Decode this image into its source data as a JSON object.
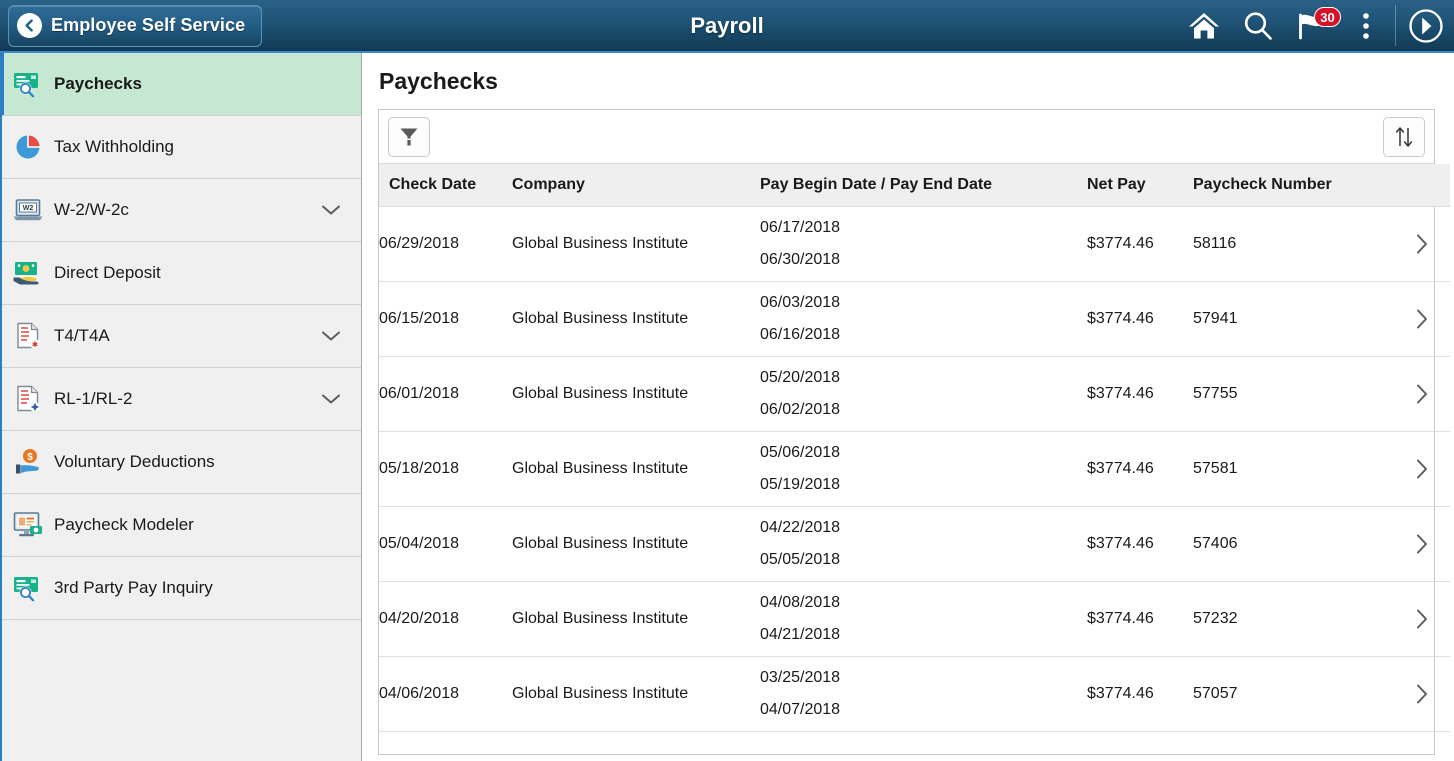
{
  "header": {
    "back_label": "Employee Self Service",
    "title": "Payroll",
    "notification_count": "30",
    "icons": {
      "home": "home-icon",
      "search": "search-icon",
      "notifications": "flag-icon",
      "actions": "kebab-menu-icon",
      "navigator": "navigator-compass-icon"
    }
  },
  "sidebar": {
    "items": [
      {
        "label": "Paychecks",
        "icon": "paycheck-search-icon",
        "selected": true,
        "expandable": false
      },
      {
        "label": "Tax Withholding",
        "icon": "pie-chart-icon",
        "selected": false,
        "expandable": false
      },
      {
        "label": "W-2/W-2c",
        "icon": "w2-laptop-icon",
        "selected": false,
        "expandable": true
      },
      {
        "label": "Direct Deposit",
        "icon": "money-hand-icon",
        "selected": false,
        "expandable": false
      },
      {
        "label": "T4/T4A",
        "icon": "t4-document-icon",
        "selected": false,
        "expandable": true
      },
      {
        "label": "RL-1/RL-2",
        "icon": "rl1-document-icon",
        "selected": false,
        "expandable": true
      },
      {
        "label": "Voluntary Deductions",
        "icon": "hand-coin-icon",
        "selected": false,
        "expandable": false
      },
      {
        "label": "Paycheck Modeler",
        "icon": "monitor-money-icon",
        "selected": false,
        "expandable": false
      },
      {
        "label": "3rd Party Pay Inquiry",
        "icon": "paycheck-search-icon",
        "selected": false,
        "expandable": false
      }
    ]
  },
  "main": {
    "page_title": "Paychecks",
    "toolbar": {
      "filter_icon": "filter-funnel-icon",
      "sort_icon": "sort-arrows-icon"
    },
    "table": {
      "columns": [
        "Check Date",
        "Company",
        "Pay Begin Date / Pay End Date",
        "Net Pay",
        "Paycheck Number"
      ],
      "rows": [
        {
          "check_date": "06/29/2018",
          "company": "Global Business Institute",
          "pay_begin": "06/17/2018",
          "pay_end": "06/30/2018",
          "net_pay": "$3774.46",
          "paycheck_number": "58116"
        },
        {
          "check_date": "06/15/2018",
          "company": "Global Business Institute",
          "pay_begin": "06/03/2018",
          "pay_end": "06/16/2018",
          "net_pay": "$3774.46",
          "paycheck_number": "57941"
        },
        {
          "check_date": "06/01/2018",
          "company": "Global Business Institute",
          "pay_begin": "05/20/2018",
          "pay_end": "06/02/2018",
          "net_pay": "$3774.46",
          "paycheck_number": "57755"
        },
        {
          "check_date": "05/18/2018",
          "company": "Global Business Institute",
          "pay_begin": "05/06/2018",
          "pay_end": "05/19/2018",
          "net_pay": "$3774.46",
          "paycheck_number": "57581"
        },
        {
          "check_date": "05/04/2018",
          "company": "Global Business Institute",
          "pay_begin": "04/22/2018",
          "pay_end": "05/05/2018",
          "net_pay": "$3774.46",
          "paycheck_number": "57406"
        },
        {
          "check_date": "04/20/2018",
          "company": "Global Business Institute",
          "pay_begin": "04/08/2018",
          "pay_end": "04/21/2018",
          "net_pay": "$3774.46",
          "paycheck_number": "57232"
        },
        {
          "check_date": "04/06/2018",
          "company": "Global Business Institute",
          "pay_begin": "03/25/2018",
          "pay_end": "04/07/2018",
          "net_pay": "$3774.46",
          "paycheck_number": "57057"
        }
      ]
    }
  },
  "colors": {
    "header_blue": "#21567a",
    "accent_blue": "#2a7ec4",
    "selected_green": "#c6e8d2",
    "badge_red": "#d8112a"
  }
}
